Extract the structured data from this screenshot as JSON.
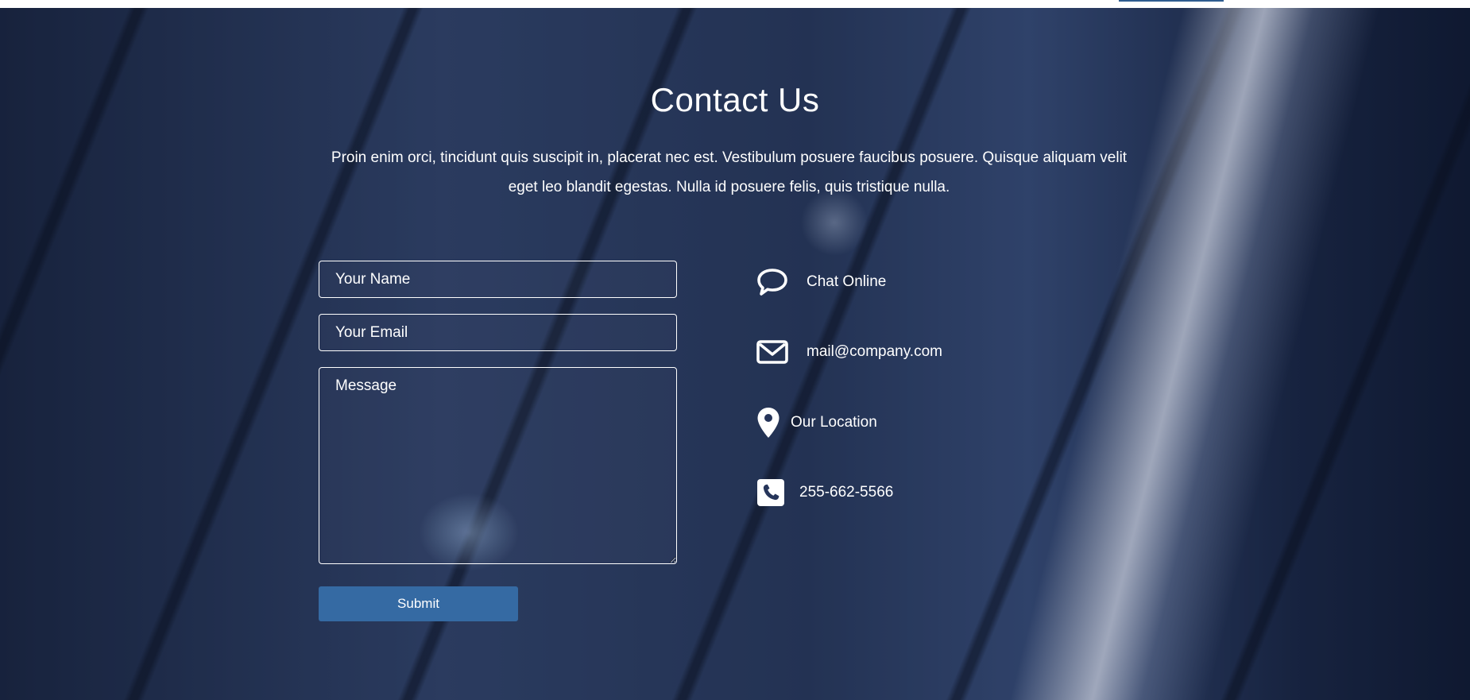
{
  "header": {
    "accent_color": "#2e5c8f"
  },
  "contact": {
    "title": "Contact Us",
    "intro": "Proin enim orci, tincidunt quis suscipit in, placerat nec est. Vestibulum posuere faucibus posuere. Quisque aliquam velit eget leo blandit egestas. Nulla id posuere felis, quis tristique nulla.",
    "form": {
      "name_placeholder": "Your Name",
      "email_placeholder": "Your Email",
      "message_placeholder": "Message",
      "submit_label": "Submit",
      "submit_color": "#356aa3"
    },
    "info": [
      {
        "icon": "chat-bubble-icon",
        "label": "Chat Online"
      },
      {
        "icon": "envelope-icon",
        "label": "mail@company.com"
      },
      {
        "icon": "map-pin-icon",
        "label": "Our Location"
      },
      {
        "icon": "phone-icon",
        "label": "255-662-5566"
      }
    ]
  }
}
